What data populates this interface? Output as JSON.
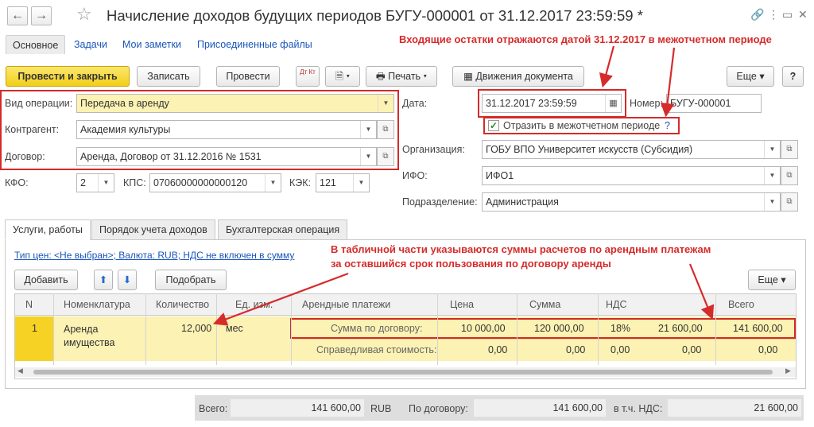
{
  "window": {
    "title": "Начисление доходов будущих периодов БУГУ-000001 от 31.12.2017 23:59:59 *",
    "back_icon": "arrow-left-icon",
    "forward_icon": "arrow-right-icon",
    "favorite_icon": "star-icon"
  },
  "nav": {
    "tabs": [
      "Основное",
      "Задачи",
      "Мои заметки",
      "Присоединенные файлы"
    ]
  },
  "annotations": {
    "top": "Входящие остатки отражаются датой  31.12.2017  в межотчетном периоде",
    "table_line1": "В табличной части указываются суммы расчетов по арендным платежам",
    "table_line2": "за оставшийся срок пользования по договору аренды"
  },
  "toolbar": {
    "post_close": "Провести и закрыть",
    "save": "Записать",
    "post": "Провести",
    "dt_kt": "Дт Кт",
    "print": "Печать",
    "movements": "Движения документа",
    "more": "Еще",
    "help": "?"
  },
  "form": {
    "op_type_label": "Вид операции:",
    "op_type_value": "Передача в аренду",
    "counterparty_label": "Контрагент:",
    "counterparty_value": "Академия культуры",
    "contract_label": "Договор:",
    "contract_value": "Аренда, Договор от 31.12.2016 № 1531",
    "kfo_label": "КФО:",
    "kfo_value": "2",
    "kps_label": "КПС:",
    "kps_value": "07060000000000120",
    "kek_label": "КЭК:",
    "kek_value": "121",
    "date_label": "Дата:",
    "date_value": "31.12.2017 23:59:59",
    "number_label": "Номер:",
    "number_value": "БУГУ-000001",
    "interperiod_label": "Отразить в межотчетном периоде",
    "interperiod_help": "?",
    "org_label": "Организация:",
    "org_value": "ГОБУ ВПО Университет искусств (Субсидия)",
    "ifo_label": "ИФО:",
    "ifo_value": "ИФО1",
    "dept_label": "Подразделение:",
    "dept_value": "Администрация"
  },
  "tabs": [
    "Услуги, работы",
    "Порядок учета доходов",
    "Бухгалтерская операция"
  ],
  "services": {
    "price_link": "Тип цен: <Не выбран>; Валюта: RUB; НДС не включен в сумму",
    "add": "Добавить",
    "pick": "Подобрать",
    "more": "Еще",
    "columns": [
      "N",
      "Номенклатура",
      "Количество",
      "Ед. изм.",
      "Арендные платежи",
      "Цена",
      "Сумма",
      "НДС",
      "",
      "Всего"
    ],
    "row": {
      "n": "1",
      "item": "Аренда имущества",
      "qty": "12,000",
      "unit": "мес",
      "line1": {
        "label": "Сумма по договору:",
        "price": "10 000,00",
        "sum": "120 000,00",
        "vat_rate": "18%",
        "vat": "21 600,00",
        "total": "141 600,00"
      },
      "line2": {
        "label": "Справедливая стоимость:",
        "price": "0,00",
        "sum": "0,00",
        "vat_rate": "0,00",
        "vat": "0,00",
        "total": "0,00"
      }
    }
  },
  "footer": {
    "total_label": "Всего:",
    "total_value": "141 600,00",
    "currency": "RUB",
    "contract_label": "По договору:",
    "contract_value": "141 600,00",
    "vat_label": "в т.ч. НДС:",
    "vat_value": "21 600,00"
  }
}
